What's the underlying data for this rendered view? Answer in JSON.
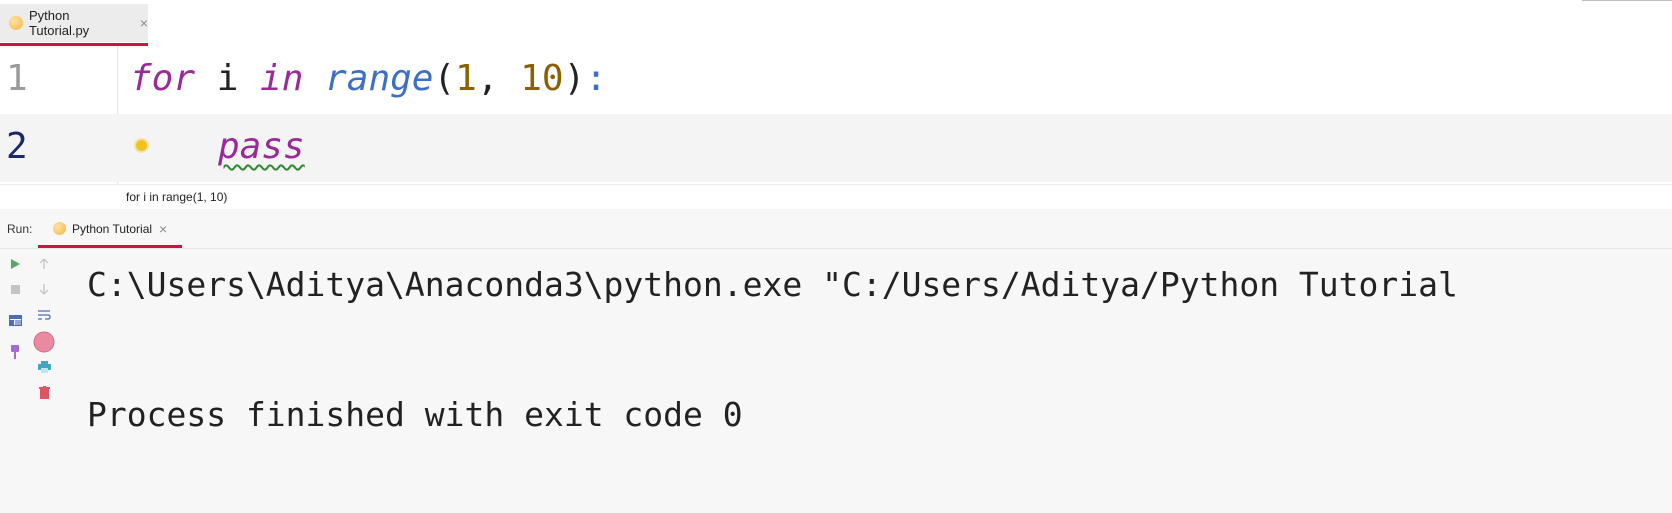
{
  "editor": {
    "tab": {
      "name": "Python Tutorial.py",
      "close": "×"
    },
    "lines": [
      {
        "number": "1",
        "tokens": {
          "kw_for": "for",
          "var": " i ",
          "kw_in": "in",
          "sp": " ",
          "fn": "range",
          "open": "(",
          "n1": "1",
          "comma": ", ",
          "n2": "10",
          "close": ")",
          "colon": ":"
        }
      },
      {
        "number": "2",
        "tokens": {
          "kw_pass": "pass"
        }
      }
    ],
    "breadcrumb": "for i in range(1, 10)"
  },
  "run": {
    "label": "Run:",
    "tab": {
      "name": "Python Tutorial",
      "close": "×"
    },
    "output": [
      "C:\\Users\\Aditya\\Anaconda3\\python.exe \"C:/Users/Aditya/Python Tutorial",
      "",
      "Process finished with exit code 0"
    ],
    "toolbar": {
      "left": [
        "rerun-icon",
        "stop-icon",
        "restore-layout-icon",
        "pin-icon"
      ],
      "right": [
        "scroll-up-icon",
        "scroll-down-icon",
        "soft-wrap-icon",
        "scroll-to-end-icon",
        "print-icon",
        "clear-all-icon"
      ]
    }
  },
  "colors": {
    "accent": "#c8163e",
    "keyword": "#9a2a9a",
    "builtin": "#3d6fc8",
    "number": "#8a6000",
    "run_green": "#59a869",
    "trash_red": "#e05561",
    "print_teal": "#3fa7c2"
  }
}
